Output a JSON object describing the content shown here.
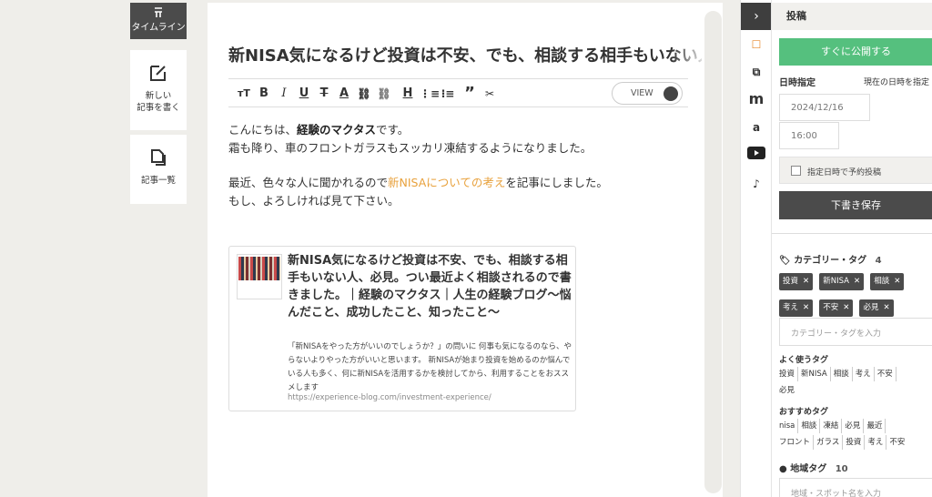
{
  "leftnav": {
    "timeline": "タイムライン",
    "new_post_line1": "新しい",
    "new_post_line2": "記事を書く",
    "post_list": "記事一覧"
  },
  "editor": {
    "title": "新NISA気になるけど投資は不安、でも、相談する相手もいない人、必見。",
    "view_label": "VIEW",
    "body": {
      "line1_pre": "こんにちは、",
      "line1_bold": "経験のマクタス",
      "line1_post": "です。",
      "line2": "霜も降り、車のフロントガラスもスッカリ凍結するようになりました。",
      "line3_pre": "最近、色々な人に聞かれるので",
      "line3_link": "新NISAについての考え",
      "line3_post": "を記事にしました。",
      "line4": "もし、よろしければ見て下さい。"
    },
    "linkcard": {
      "title": "新NISA気になるけど投資は不安、でも、相談する相手もいない人、必見。つい最近よく相談されるので書きました。｜経験のマクタス｜人生の経験ブログ〜悩んだこと、成功したこと、知ったこと〜",
      "description": "「新NISAをやった方がいいのでしょうか？」の問いに 何事も気になるのなら、やらないよりやった方がいいと思います。 新NISAが始まり投資を始めるのか悩んでいる人も多く、何に新NISAを活用するかを検討してから、利用することをおススメします",
      "url": "https://experience-blog.com/investment-experience/"
    }
  },
  "panel": {
    "header": "投稿",
    "publish_now": "すぐに公開する",
    "schedule_label": "日時指定",
    "current_datetime": "現在の日時を指定",
    "date_placeholder": "2024/12/16",
    "time_placeholder": "16:00",
    "scheduled_checkbox": "指定日時で予約投稿",
    "save_draft": "下書き保存",
    "category_label": "カテゴリー・タグ",
    "category_count": "4",
    "tags": [
      "投資",
      "新NISA",
      "相談",
      "考え",
      "不安",
      "必見"
    ],
    "tag_input_placeholder": "カテゴリー・タグを入力",
    "frequent_label": "よく使うタグ",
    "frequent_tags": [
      "投資",
      "新NISA",
      "相談",
      "考え",
      "不安",
      "必見"
    ],
    "recommended_label": "おすすめタグ",
    "recommended_tags": [
      "nisa",
      "相談",
      "凍結",
      "必見",
      "最近",
      "フロント",
      "ガラス",
      "投資",
      "考え",
      "不安"
    ],
    "region_label": "地域タグ",
    "region_count": "10",
    "region_input_placeholder": "地域・スポット名を入力"
  },
  "colors": {
    "accent_green": "#55c07e",
    "link_orange": "#e8a13c",
    "dark": "#4b4b4b"
  }
}
